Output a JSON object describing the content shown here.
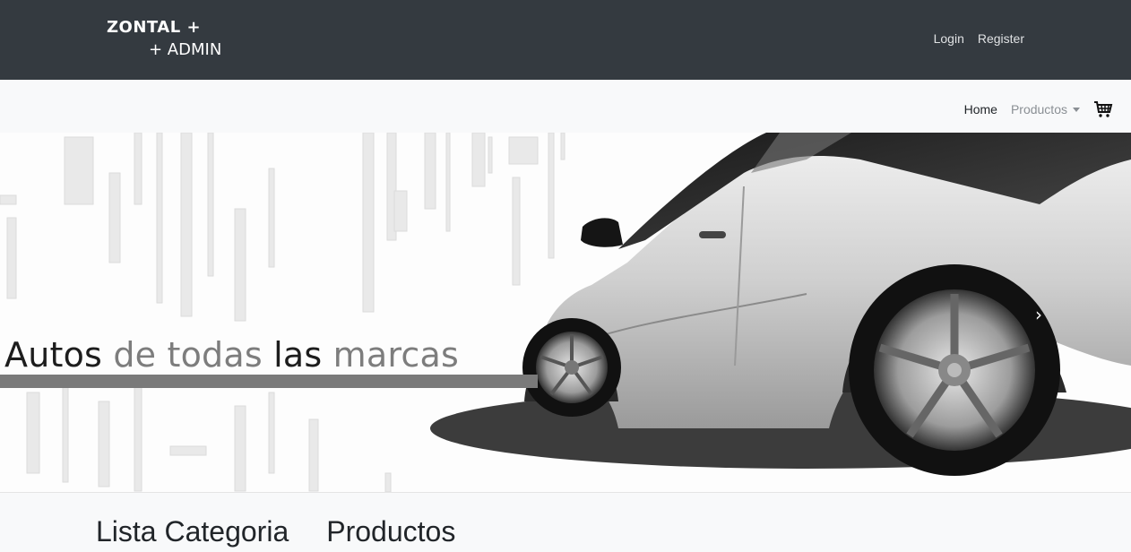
{
  "brand": {
    "line1": "ZONTAL +",
    "line2": "+ ADMIN"
  },
  "auth": {
    "login": "Login",
    "register": "Register"
  },
  "nav": {
    "home": "Home",
    "productos": "Productos",
    "cart_icon": "cart-icon"
  },
  "hero": {
    "word1": "Autos",
    "word2": "de todas",
    "word3": "las",
    "word4": "marcas",
    "next_icon": "chevron-right-icon"
  },
  "sections": {
    "categories": "Lista Categoria",
    "products": "Productos"
  },
  "colors": {
    "topbar": "#343a40",
    "navbar": "#f8f9fa",
    "hero_bar": "#7a7a7a"
  }
}
